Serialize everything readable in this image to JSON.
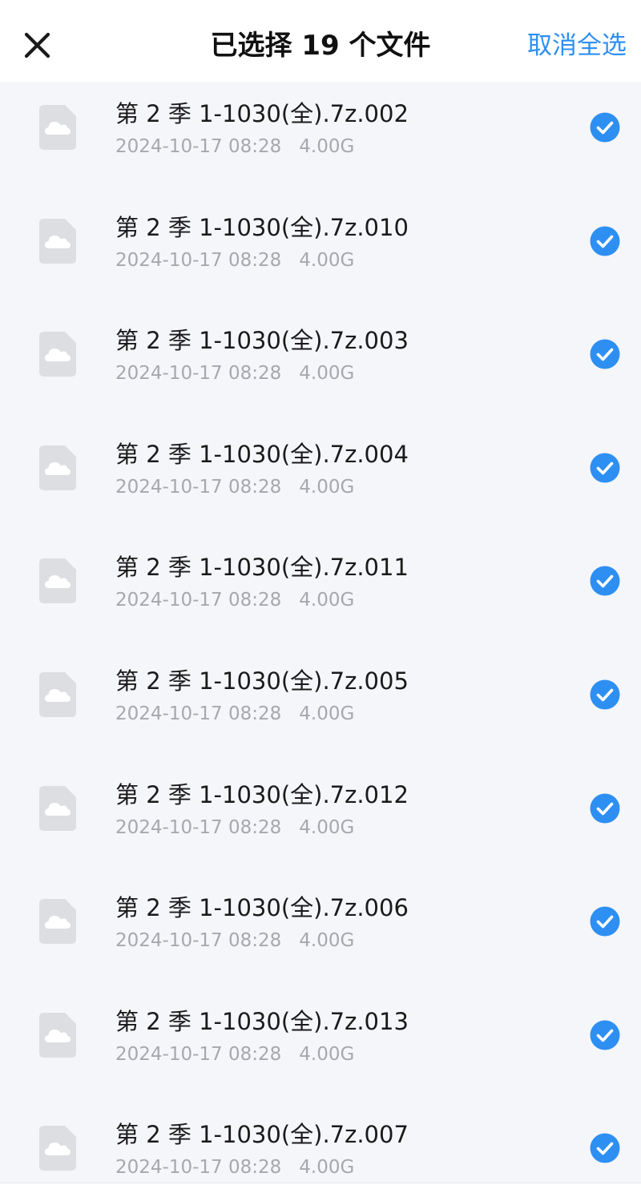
{
  "header": {
    "close_icon": "close-icon",
    "title": "已选择 19 个文件",
    "cancel_select_all": "取消全选",
    "accent_color": "#2e8ff3"
  },
  "files": [
    {
      "name": "第 2 季 1-1030(全).7z.002",
      "date": "2024-10-17 08:28",
      "size": "4.00G",
      "selected": true
    },
    {
      "name": "第 2 季 1-1030(全).7z.010",
      "date": "2024-10-17 08:28",
      "size": "4.00G",
      "selected": true
    },
    {
      "name": "第 2 季 1-1030(全).7z.003",
      "date": "2024-10-17 08:28",
      "size": "4.00G",
      "selected": true
    },
    {
      "name": "第 2 季 1-1030(全).7z.004",
      "date": "2024-10-17 08:28",
      "size": "4.00G",
      "selected": true
    },
    {
      "name": "第 2 季 1-1030(全).7z.011",
      "date": "2024-10-17 08:28",
      "size": "4.00G",
      "selected": true
    },
    {
      "name": "第 2 季 1-1030(全).7z.005",
      "date": "2024-10-17 08:28",
      "size": "4.00G",
      "selected": true
    },
    {
      "name": "第 2 季 1-1030(全).7z.012",
      "date": "2024-10-17 08:28",
      "size": "4.00G",
      "selected": true
    },
    {
      "name": "第 2 季 1-1030(全).7z.006",
      "date": "2024-10-17 08:28",
      "size": "4.00G",
      "selected": true
    },
    {
      "name": "第 2 季 1-1030(全).7z.013",
      "date": "2024-10-17 08:28",
      "size": "4.00G",
      "selected": true
    },
    {
      "name": "第 2 季 1-1030(全).7z.007",
      "date": "2024-10-17 08:28",
      "size": "4.00G",
      "selected": true
    }
  ],
  "icons": {
    "file": "cloud-file-icon",
    "check": "check-circle-icon"
  }
}
